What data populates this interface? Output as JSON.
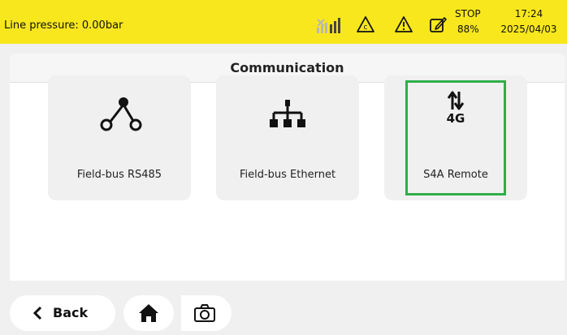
{
  "status": {
    "pressure": "Line pressure: 0.00bar",
    "mode": "STOP",
    "battery": "88%",
    "time": "17:24",
    "date": "2025/04/03",
    "icons": [
      "signal-icon",
      "c-warning-icon",
      "warning-icon",
      "edit-icon"
    ]
  },
  "panel": {
    "title": "Communication"
  },
  "tiles": [
    {
      "label": "Field-bus RS485",
      "icon": "rs485-network-icon"
    },
    {
      "label": "Field-bus Ethernet",
      "icon": "ethernet-network-icon"
    },
    {
      "label": "S4A Remote",
      "icon": "4g-transfer-icon",
      "icon_text": "4G",
      "selected": true
    }
  ],
  "footer": {
    "back_label": "Back",
    "icons": [
      "chevron-left-icon",
      "home-icon",
      "camera-icon"
    ]
  },
  "colors": {
    "status_bar": "#f8e71c",
    "selection": "#2fae4a"
  }
}
